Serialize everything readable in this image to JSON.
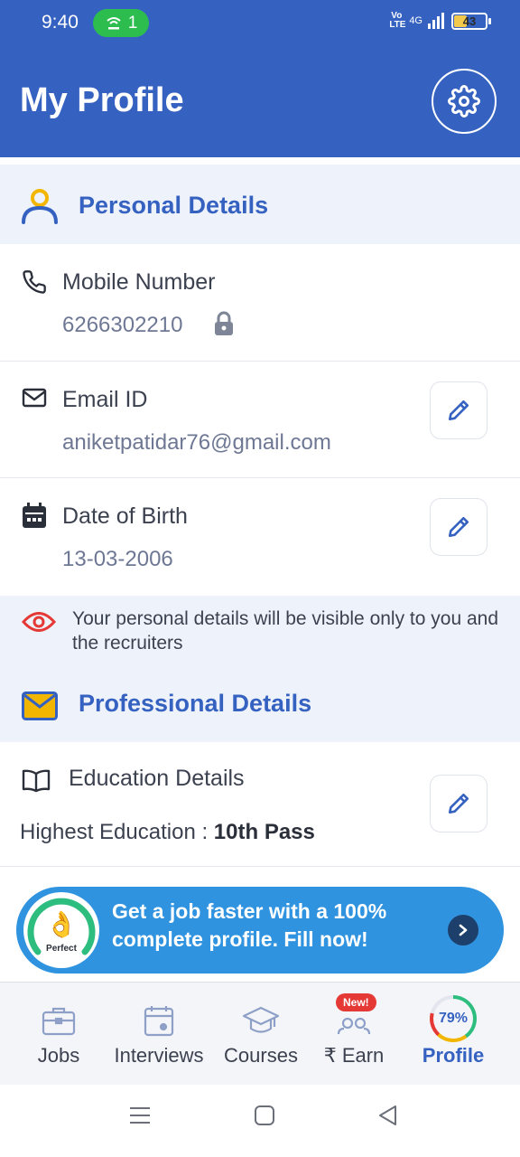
{
  "status_bar": {
    "time": "9:40",
    "hotspot_count": "1",
    "network": "4G",
    "volte": "Vo LTE",
    "battery": "43"
  },
  "header": {
    "title": "My Profile"
  },
  "personal": {
    "title": "Personal Details",
    "mobile_label": "Mobile Number",
    "mobile_value": "6266302210",
    "email_label": "Email ID",
    "email_value": "aniketpatidar76@gmail.com",
    "dob_label": "Date of Birth",
    "dob_value": "13-03-2006",
    "notice": "Your personal details will be visible only to you and the recruiters"
  },
  "professional": {
    "title": "Professional Details",
    "education_label": "Education Details",
    "highest_label": "Highest Education : ",
    "highest_value": "10th Pass"
  },
  "banner": {
    "gauge_label": "Perfect",
    "text": "Get a job faster with a 100% complete profile. Fill now!"
  },
  "bottom_nav": {
    "items": [
      {
        "label": "Jobs"
      },
      {
        "label": "Interviews"
      },
      {
        "label": "Courses"
      },
      {
        "label": "₹ Earn",
        "badge": "New!"
      },
      {
        "label": "Profile",
        "progress": "79%"
      }
    ]
  },
  "colors": {
    "primary": "#3562c1",
    "banner": "#2f93e0",
    "accent": "#f2b500",
    "danger": "#e53935"
  }
}
